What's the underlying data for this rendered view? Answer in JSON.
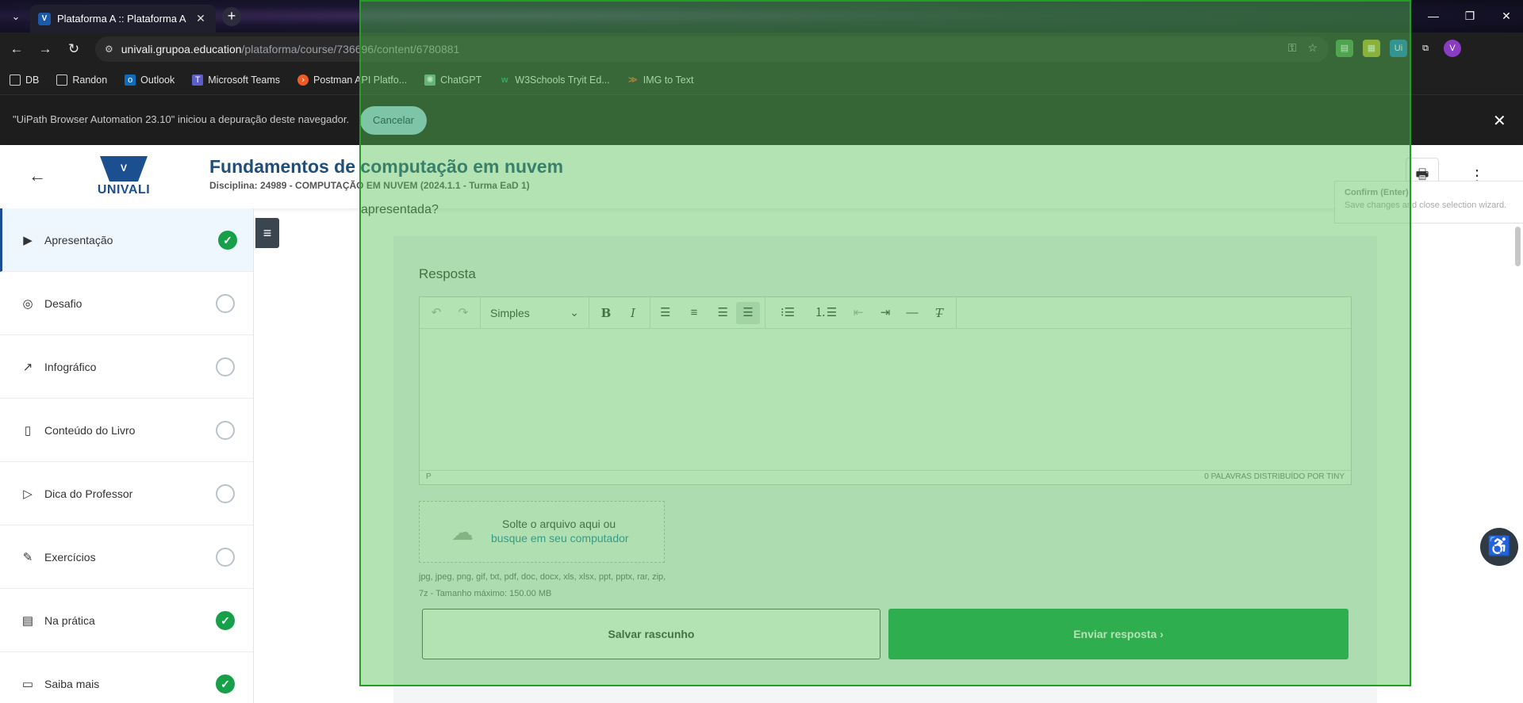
{
  "browser": {
    "tab": {
      "title": "Plataforma A :: Plataforma A",
      "favicon": "V",
      "close_icon": "✕"
    },
    "new_tab_icon": "+",
    "tab_list_icon": "⌄",
    "window": {
      "minimize": "—",
      "restore": "❐",
      "close": "✕"
    },
    "nav": {
      "back": "←",
      "forward": "→",
      "reload": "↻"
    },
    "url_host": "univali.grupoa.education",
    "url_path": "/plataforma/course/736696/content/6780881",
    "omni_icons": {
      "password": "⚿",
      "star": "☆"
    },
    "extensions": [
      "▤",
      "▦",
      "Ui",
      "⧉"
    ],
    "profile_initial": "V",
    "bookmarks": [
      {
        "label": "DB",
        "icon": "folder-icon"
      },
      {
        "label": "Randon",
        "icon": "folder-icon"
      },
      {
        "label": "Outlook",
        "icon": "outlook-icon"
      },
      {
        "label": "Microsoft Teams",
        "icon": "teams-icon"
      },
      {
        "label": "Postman API Platfo...",
        "icon": "postman-icon"
      },
      {
        "label": "ChatGPT",
        "icon": "chatgpt-icon"
      },
      {
        "label": "W3Schools Tryit Ed...",
        "icon": "w3schools-icon"
      },
      {
        "label": "IMG to Text",
        "icon": "img-to-text-icon"
      }
    ],
    "infobar": {
      "text": "\"UiPath Browser Automation 23.10\" iniciou a depuração deste navegador.",
      "cancel_label": "Cancelar",
      "close_icon": "✕"
    }
  },
  "header": {
    "back_icon": "←",
    "logo_text": "UNIVALI",
    "title": "Fundamentos de computação em nuvem",
    "subtitle": "Disciplina: 24989 - COMPUTAÇÃO EM NUVEM (2024.1.1 - Turma EaD 1)",
    "print_icon": "🖶",
    "more_icon": "⋮"
  },
  "tooltip": {
    "title": "Confirm (Enter)",
    "desc": "Save changes and close selection wizard."
  },
  "sidebar": {
    "toggle_icon": "≡",
    "items": [
      {
        "label": "Apresentação",
        "icon": "▶",
        "done": true,
        "active": true
      },
      {
        "label": "Desafio",
        "icon": "◎",
        "done": false
      },
      {
        "label": "Infográfico",
        "icon": "↗",
        "done": false
      },
      {
        "label": "Conteúdo do Livro",
        "icon": "▯",
        "done": false
      },
      {
        "label": "Dica do Professor",
        "icon": "▷",
        "done": false
      },
      {
        "label": "Exercícios",
        "icon": "✎",
        "done": false
      },
      {
        "label": "Na prática",
        "icon": "▤",
        "done": true
      },
      {
        "label": "Saiba mais",
        "icon": "▭",
        "done": true
      }
    ],
    "check_icon": "✓"
  },
  "content": {
    "fragment_text": "apresentada?",
    "answer_title": "Resposta",
    "editor": {
      "undo_icon": "↶",
      "redo_icon": "↷",
      "block_format": "Simples",
      "dropdown_icon": "⌄",
      "bold_icon": "B",
      "italic_icon": "I",
      "align_left_icon": "☰",
      "align_center_icon": "≡",
      "align_right_icon": "☰",
      "justify_icon": "☰",
      "bullist_icon": "⁝☰",
      "numlist_icon": "⒈☰",
      "outdent_icon": "⇤",
      "indent_icon": "⇥",
      "hr_icon": "—",
      "clear_format_icon": "T̶",
      "status_path": "P",
      "status_words": "0 PALAVRAS  DISTRIBUÍDO POR TINY"
    },
    "dropzone": {
      "cloud_icon": "☁",
      "line1": "Solte o arquivo aqui ou",
      "line2": "busque em seu computador"
    },
    "file_types": "jpg, jpeg, png, gif, txt, pdf, doc, docx, xls, xlsx, ppt, pptx, rar, zip, 7z - Tamanho máximo: 150.00 MB",
    "save_draft_label": "Salvar rascunho",
    "send_label": "Enviar resposta  ›"
  },
  "accessibility_icon": "♿",
  "colors": {
    "overlay": "#56be56",
    "brand": "#1b4f8f",
    "success": "#16a04a"
  }
}
